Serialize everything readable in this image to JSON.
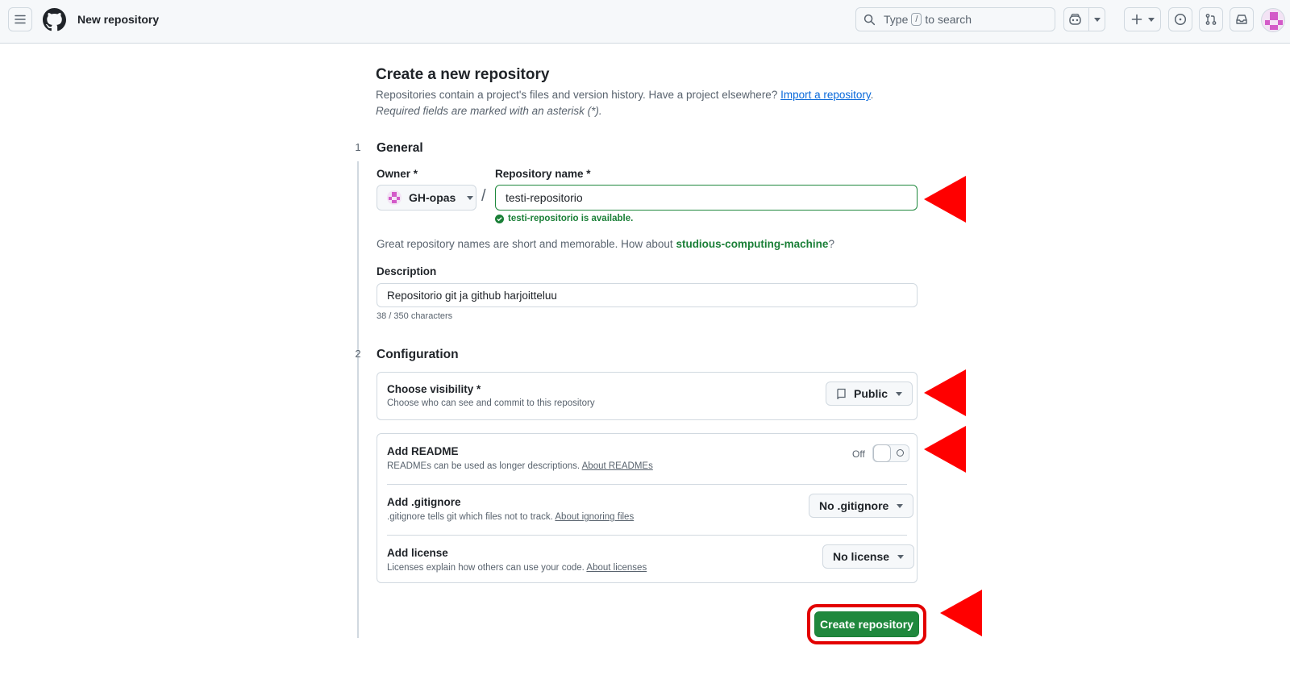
{
  "header": {
    "title": "New repository",
    "search_prefix": "Type",
    "search_key": "/",
    "search_suffix": "to search"
  },
  "page": {
    "heading": "Create a new repository",
    "intro_text": "Repositories contain a project's files and version history. Have a project elsewhere? ",
    "import_link": "Import a repository",
    "intro_end": ".",
    "required_note": "Required fields are marked with an asterisk (*)."
  },
  "general": {
    "step": "1",
    "title": "General",
    "owner_label": "Owner *",
    "owner_value": "GH-opas",
    "slash": "/",
    "repo_name_label": "Repository name *",
    "repo_name_value": "testi-repositorio",
    "availability": "testi-repositorio is available.",
    "suggestion_prefix": "Great repository names are short and memorable. How about ",
    "suggestion_name": "studious-computing-machine",
    "suggestion_suffix": "?",
    "description_label": "Description",
    "description_value": "Repositorio git ja github harjoitteluu",
    "char_count": "38 / 350 characters"
  },
  "configuration": {
    "step": "2",
    "title": "Configuration",
    "visibility_title": "Choose visibility *",
    "visibility_sub": "Choose who can see and commit to this repository",
    "visibility_value": "Public",
    "readme_title": "Add README",
    "readme_sub": "READMEs can be used as longer descriptions. ",
    "readme_link": "About READMEs",
    "readme_toggle_label": "Off",
    "gitignore_title": "Add .gitignore",
    "gitignore_sub": ".gitignore tells git which files not to track. ",
    "gitignore_link": "About ignoring files",
    "gitignore_value": "No .gitignore",
    "license_title": "Add license",
    "license_sub": "Licenses explain how others can use your code. ",
    "license_link": "About licenses",
    "license_value": "No license"
  },
  "actions": {
    "create_label": "Create repository"
  },
  "colors": {
    "accent_green": "#1f883d",
    "annotation_red": "#ff0000",
    "link_blue": "#0969da"
  }
}
